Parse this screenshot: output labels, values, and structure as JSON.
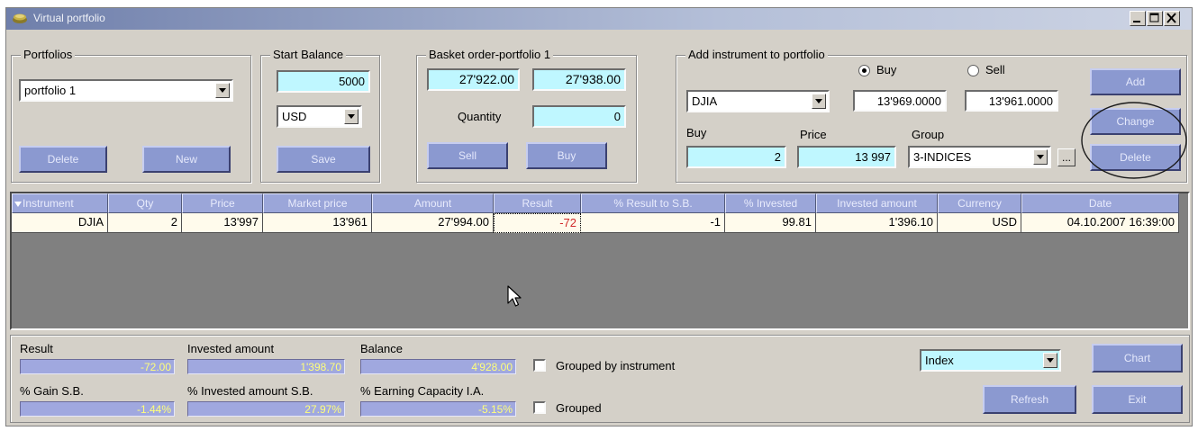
{
  "window": {
    "title": "Virtual portfolio"
  },
  "portfolios": {
    "legend": "Portfolios",
    "selected": "portfolio 1",
    "delete_label": "Delete",
    "new_label": "New"
  },
  "start_balance": {
    "legend": "Start Balance",
    "value": "5000",
    "currency": "USD",
    "save_label": "Save"
  },
  "basket": {
    "legend": "Basket order-portfolio 1",
    "price_a": "27'922.00",
    "price_b": "27'938.00",
    "quantity_label": "Quantity",
    "quantity": "0",
    "sell_label": "Sell",
    "buy_label": "Buy"
  },
  "add_instrument": {
    "legend": "Add instrument to portfolio",
    "instrument": "DJIA",
    "buy_radio": "Buy",
    "sell_radio": "Sell",
    "buy_quote": "13'969.0000",
    "sell_quote": "13'961.0000",
    "buy_label": "Buy",
    "price_label": "Price",
    "group_label": "Group",
    "buy_value": "2",
    "price_value": "13 997",
    "group_value": "3-INDICES",
    "dots_label": "...",
    "add_label": "Add",
    "change_label": "Change",
    "delete_label": "Delete"
  },
  "table": {
    "columns": [
      "Instrument",
      "Qty",
      "Price",
      "Market price",
      "Amount",
      "Result",
      "% Result to S.B.",
      "% Invested",
      "Invested amount",
      "Currency",
      "Date"
    ],
    "rows": [
      [
        "DJIA",
        "2",
        "13'997",
        "13'961",
        "27'994.00",
        "-72",
        "-1",
        "99.81",
        "1'396.10",
        "USD",
        "04.10.2007 16:39:00"
      ]
    ]
  },
  "summary": {
    "result_label": "Result",
    "result_value": "-72.00",
    "invested_label": "Invested amount",
    "invested_value": "1'398.70",
    "balance_label": "Balance",
    "balance_value": "4'928.00",
    "grouped_by_instrument_label": "Grouped by instrument",
    "gain_label": "% Gain S.B.",
    "gain_value": "-1.44%",
    "invested_sb_label": "% Invested amount S.B.",
    "invested_sb_value": "27.97%",
    "earning_label": "% Earning Capacity I.A.",
    "earning_value": "-5.15%",
    "grouped_label": "Grouped",
    "chart_type": "Index",
    "chart_label": "Chart",
    "refresh_label": "Refresh",
    "exit_label": "Exit"
  },
  "colors": {
    "button": "#8b99d0",
    "field": "#bff7ff",
    "header": "#9ba6d9",
    "negative": "#d12a2a"
  }
}
